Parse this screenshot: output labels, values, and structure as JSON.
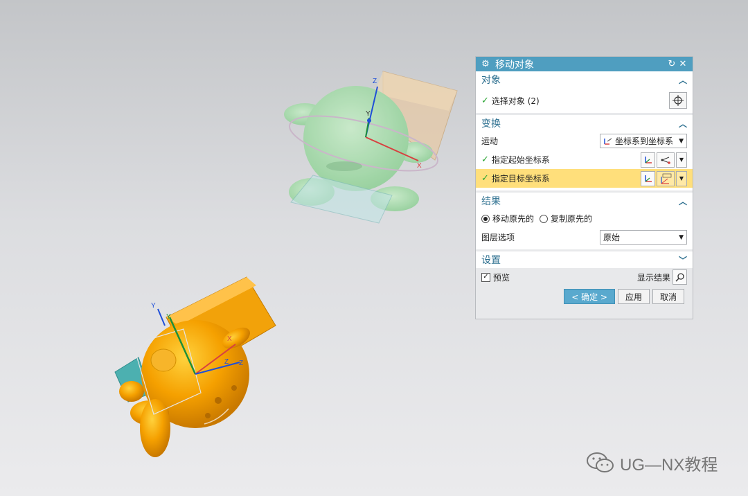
{
  "dialog": {
    "title": "移动对象",
    "title_icon": "gear-icon",
    "sections": {
      "object": {
        "header": "对象",
        "select_label": "选择对象 (2)"
      },
      "transform": {
        "header": "变换",
        "motion_label": "运动",
        "motion_value": "坐标系到坐标系",
        "start_csys_label": "指定起始坐标系",
        "target_csys_label": "指定目标坐标系"
      },
      "result": {
        "header": "结果",
        "move_original": "移动原先的",
        "copy_original": "复制原先的",
        "layer_label": "图层选项",
        "layer_value": "原始"
      },
      "settings": {
        "header": "设置"
      }
    },
    "preview_label": "预览",
    "show_result_label": "显示结果",
    "ok_label": "< 确定 >",
    "apply_label": "应用",
    "cancel_label": "取消"
  },
  "axis_labels": {
    "z": "Z",
    "y": "Y",
    "x": "X"
  },
  "watermark": "UG—NX教程",
  "colors": {
    "title_bar": "#4f9ec0",
    "section_header": "#2c6f8f",
    "highlight_row": "#ffdf7b",
    "ok_button": "#59a9ce",
    "check": "#2aa534",
    "ghost_model": "#9fd8a4",
    "active_model": "#f5a000"
  }
}
